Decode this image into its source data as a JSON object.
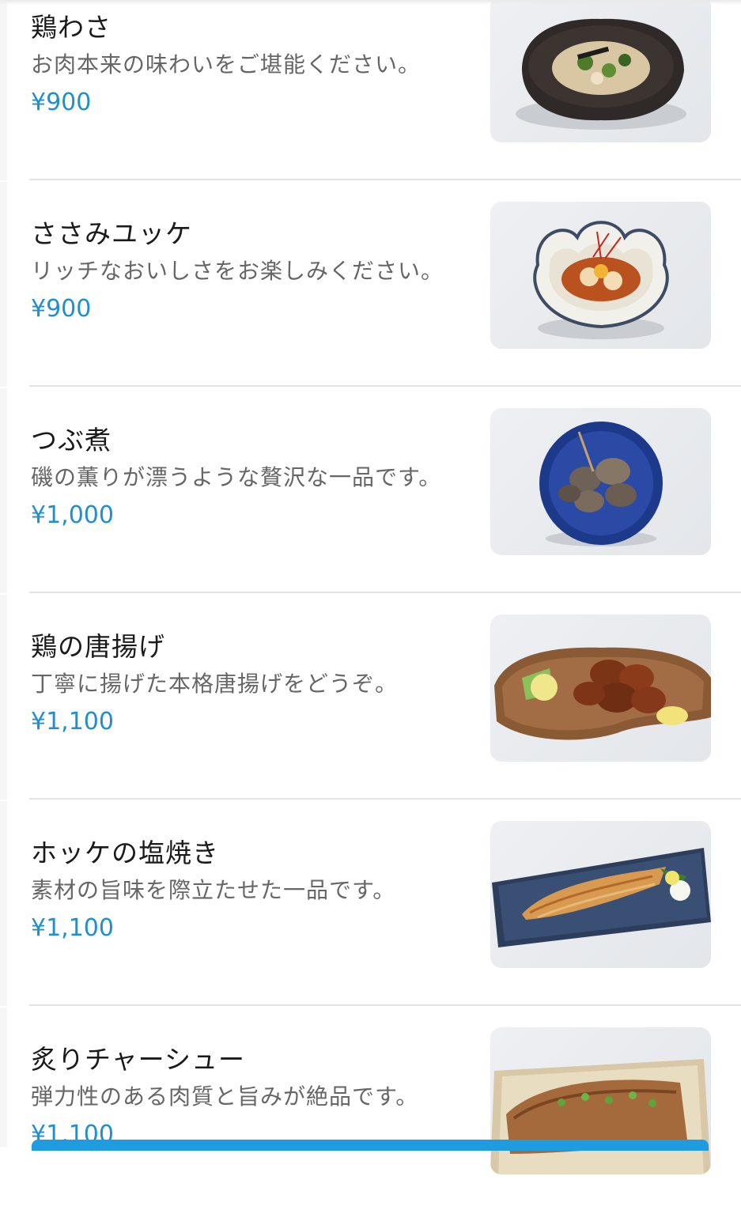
{
  "menu": {
    "items": [
      {
        "name": "鶏わさ",
        "description": "お肉本来の味わいをご堪能ください。",
        "price": "¥900",
        "image_icon": "dish-photo-toriwasa"
      },
      {
        "name": "ささみユッケ",
        "description": "リッチなおいしさをお楽しみください。",
        "price": "¥900",
        "image_icon": "dish-photo-sasami-yukke"
      },
      {
        "name": "つぶ煮",
        "description": "磯の薫りが漂うような贅沢な一品です。",
        "price": "¥1,000",
        "image_icon": "dish-photo-tsubu-ni"
      },
      {
        "name": "鶏の唐揚げ",
        "description": "丁寧に揚げた本格唐揚げをどうぞ。",
        "price": "¥1,100",
        "image_icon": "dish-photo-karaage"
      },
      {
        "name": "ホッケの塩焼き",
        "description": "素材の旨味を際立たせた一品です。",
        "price": "¥1,100",
        "image_icon": "dish-photo-hokke"
      },
      {
        "name": "炙りチャーシュー",
        "description": "弾力性のある肉質と旨みが絶品です。",
        "price": "¥1,100",
        "image_icon": "dish-photo-chashu"
      }
    ]
  },
  "colors": {
    "price": "#1e8fd0",
    "accent_bar": "#1f9be0",
    "divider": "#e3e3e3"
  }
}
